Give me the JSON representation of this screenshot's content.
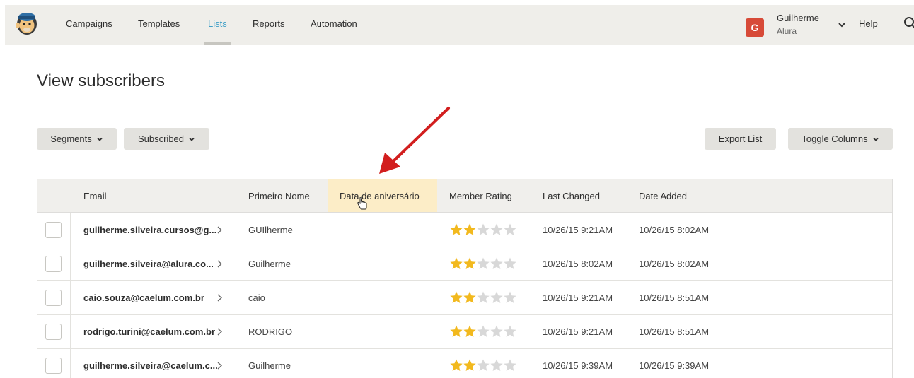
{
  "nav": {
    "items": [
      "Campaigns",
      "Templates",
      "Lists",
      "Reports",
      "Automation"
    ],
    "active": "Lists",
    "avatar_letter": "G",
    "user_name": "Guilherme",
    "user_org": "Alura",
    "help": "Help"
  },
  "page_title": "View subscribers",
  "toolbar": {
    "segments": "Segments",
    "subscribed": "Subscribed",
    "export": "Export List",
    "toggle_columns": "Toggle Columns"
  },
  "table": {
    "columns": [
      "Email",
      "Primeiro Nome",
      "Data de aniversário",
      "Member Rating",
      "Last Changed",
      "Date Added"
    ],
    "rows": [
      {
        "email": "guilherme.silveira.cursos@g...",
        "name": "GUIlherme",
        "rating": 2,
        "last_changed": "10/26/15 9:21AM",
        "date_added": "10/26/15 8:02AM"
      },
      {
        "email": "guilherme.silveira@alura.co...",
        "name": "Guilherme",
        "rating": 2,
        "last_changed": "10/26/15 8:02AM",
        "date_added": "10/26/15 8:02AM"
      },
      {
        "email": "caio.souza@caelum.com.br",
        "name": "caio",
        "rating": 2,
        "last_changed": "10/26/15 9:21AM",
        "date_added": "10/26/15 8:51AM"
      },
      {
        "email": "rodrigo.turini@caelum.com.br",
        "name": "RODRIGO",
        "rating": 2,
        "last_changed": "10/26/15 9:21AM",
        "date_added": "10/26/15 8:51AM"
      },
      {
        "email": "guilherme.silveira@caelum.c...",
        "name": "Guilherme",
        "rating": 2,
        "last_changed": "10/26/15 9:39AM",
        "date_added": "10/26/15 9:39AM"
      }
    ],
    "max_rating": 5
  },
  "colors": {
    "accent": "#3e9fc7",
    "avatar": "#d74a38",
    "star_on": "#f2b91e",
    "star_off": "#d8d8d8",
    "highlight": "#fcedc7",
    "arrow": "#d21e1e"
  }
}
